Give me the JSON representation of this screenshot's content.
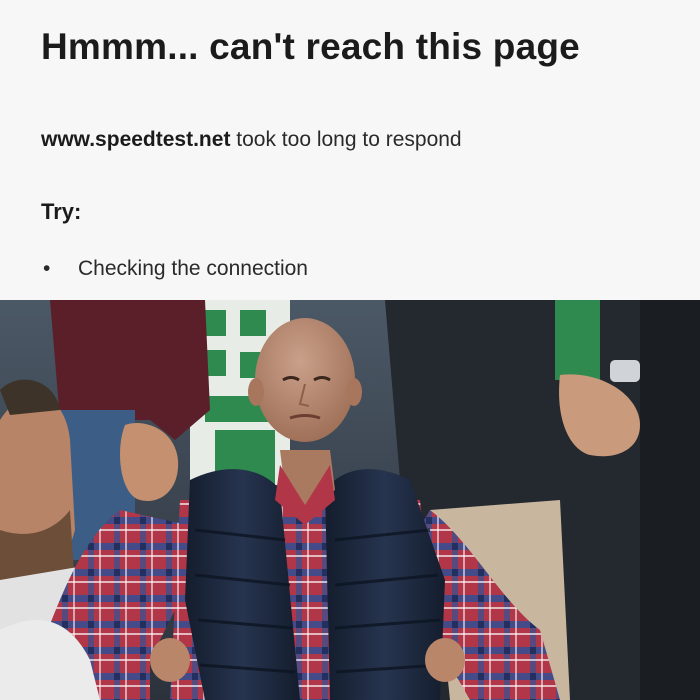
{
  "error_page": {
    "title": "Hmmm... can't reach this page",
    "domain": "www.speedtest.net",
    "message_suffix": " took too long to respond",
    "try_heading": "Try:",
    "suggestions": [
      {
        "bullet": "•",
        "label": "Checking the connection"
      }
    ]
  },
  "photo": {
    "subject": "man in navy puffer vest and red plaid shirt standing with hands on hips in a stadium crowd",
    "palette": {
      "background_stands": "#3e4a58",
      "green_accent": "#2f8a4f",
      "vest": "#1d2a40",
      "shirt_red": "#b13648",
      "shirt_blue": "#3a4e90",
      "skin": "#b9866a"
    }
  }
}
